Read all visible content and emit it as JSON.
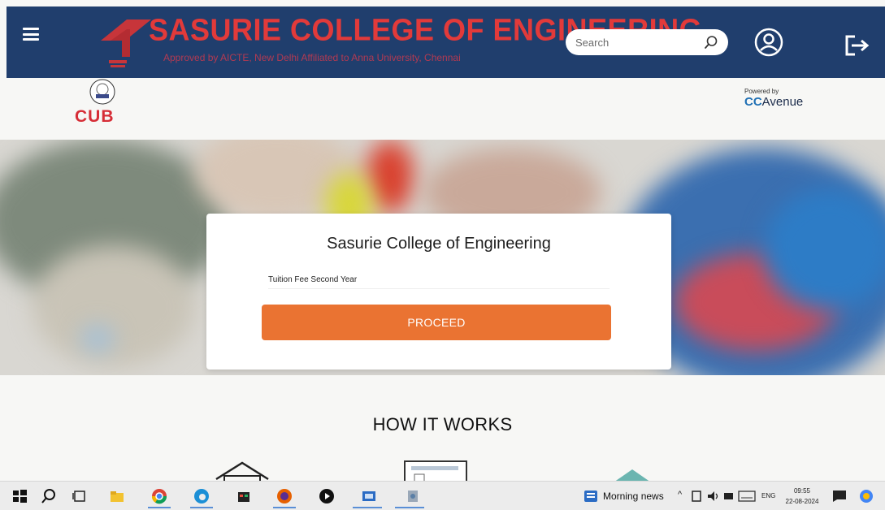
{
  "header": {
    "menu_icon": "hamburger-menu-icon",
    "college_name": "SASURIE COLLEGE OF ENGINEERING",
    "tagline": "Approved by AICTE, New Delhi   Affiliated to Anna University, Chennai",
    "search_placeholder": "Search",
    "search_icon": "search-icon",
    "user_icon": "user-profile-icon",
    "logout_icon": "logout-icon",
    "background_color": "#203e6d",
    "title_color": "#e23a3a"
  },
  "subbar": {
    "bank_logo_text": "CUB",
    "powered_by": "Powered by",
    "gateway_cc": "CC",
    "gateway_name": "Avenue"
  },
  "payment_card": {
    "title": "Sasurie College of Engineering",
    "fee_label": "Tuition Fee Second Year",
    "proceed_label": "PROCEED",
    "button_color": "#ea7332"
  },
  "how_it_works": {
    "heading": "HOW IT WORKS"
  },
  "taskbar": {
    "apps": [
      "windows-start-icon",
      "search-icon",
      "task-view-icon",
      "file-explorer-icon",
      "chrome-icon",
      "edge-icon",
      "store-icon",
      "firefox-icon",
      "media-icon",
      "app-icon",
      "app-icon-2"
    ],
    "news_label": "Morning news",
    "language": "ENG",
    "time": "09:55",
    "date": "22-08-2024"
  }
}
